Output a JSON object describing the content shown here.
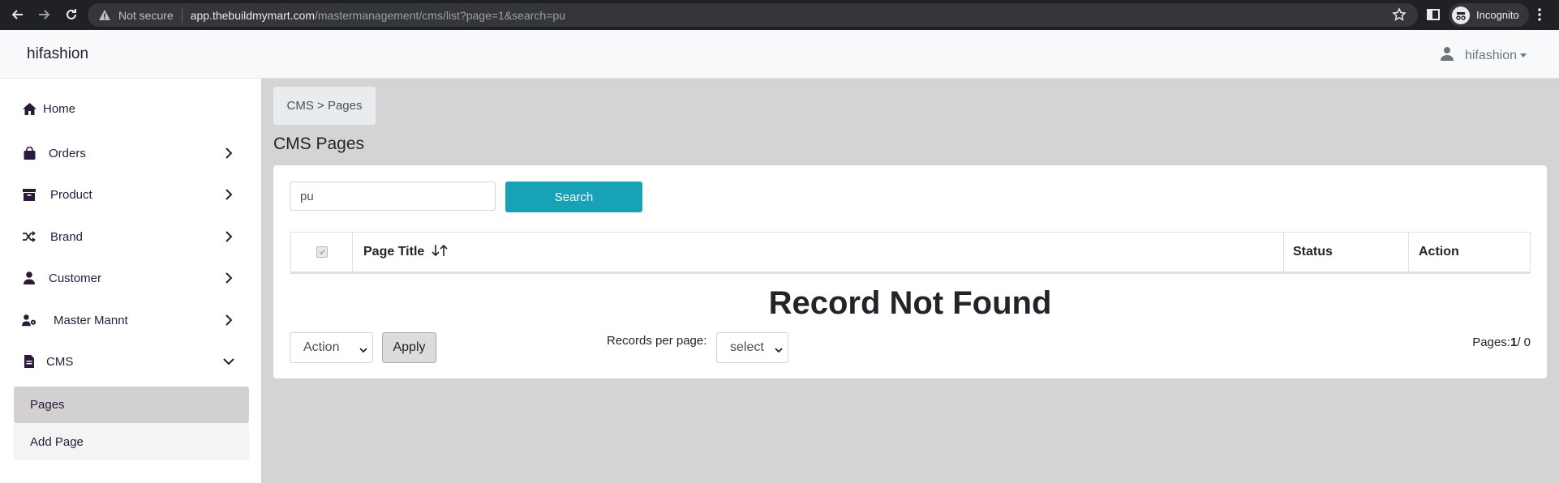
{
  "browser": {
    "security_label": "Not secure",
    "url_host": "app.thebuildmymart.com",
    "url_path": "/mastermanagement/cms/list?page=1&search=pu",
    "profile_label": "Incognito"
  },
  "header": {
    "brand": "hifashion",
    "user_name": "hifashion"
  },
  "sidebar": {
    "items": [
      {
        "label": "Home",
        "icon": "home-icon"
      },
      {
        "label": "Orders",
        "icon": "shopping-bag-icon"
      },
      {
        "label": "Product",
        "icon": "archive-icon"
      },
      {
        "label": "Brand",
        "icon": "shuffle-icon"
      },
      {
        "label": "Customer",
        "icon": "user-icon"
      },
      {
        "label": "Master Mannt",
        "icon": "user-gear-icon"
      },
      {
        "label": "CMS",
        "icon": "file-icon"
      }
    ],
    "cms_subitems": [
      {
        "label": "Pages",
        "active": true
      },
      {
        "label": "Add Page",
        "active": false
      }
    ]
  },
  "main": {
    "breadcrumb": "CMS > Pages",
    "title": "CMS Pages",
    "search": {
      "value": "pu",
      "button_label": "Search"
    },
    "table": {
      "columns": [
        "Page Title",
        "Status",
        "Action"
      ]
    },
    "empty_message": "Record Not Found",
    "bulk_action": {
      "selected": "Action",
      "apply_label": "Apply"
    },
    "records_per_page": {
      "label": "Records per page:",
      "selected": "select"
    },
    "pagination": {
      "prefix": "Pages:",
      "current": "1",
      "suffix": "/ 0"
    }
  },
  "colors": {
    "primary_button": "#17a2b8",
    "sidebar_text": "#2b1a3d",
    "content_bg": "#d4d4d4"
  }
}
